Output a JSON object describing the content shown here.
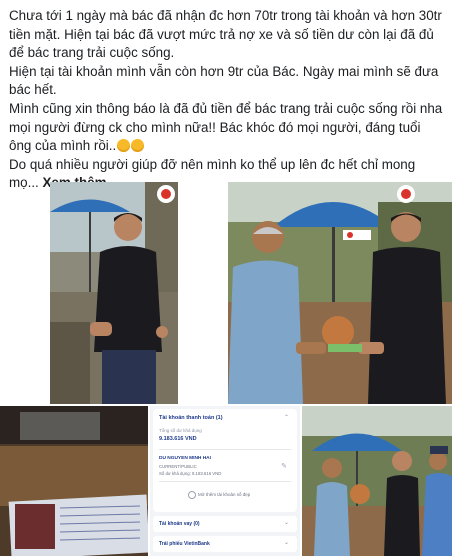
{
  "post": {
    "line1": "Chưa tới 1 ngày mà bác đã nhận đc hơn 70tr trong tài khoản và hơn 30tr tiền mặt. Hiện tại bác đã vượt mức trả nợ xe và số tiền dư còn lại đã đủ để bác trang trải cuộc sống.",
    "line2": "Hiện tại tài khoản mình vẫn còn hơn 9tr của Bác. Ngày mai mình sẽ đưa bác hết.",
    "line3": "Mình cũng xin thông báo là đã đủ tiền để bác trang trải cuộc sống rồi nha mọi người đừng ck cho mình nữa!! Bác khóc đó mọi người, đáng tuổi ông của mình rồi..",
    "line4": "Do quá nhiều người giúp đỡ nên mình ko thể up lên đc hết chỉ mong mọ...",
    "see_more": "Xem thêm"
  },
  "bank_app": {
    "card_title": "Tài khoản thanh toán (1)",
    "balance_label": "Tổng số dư khả dụng",
    "balance_value": "9.183.616 VND",
    "holder_name": "DU NGUYEN MINH HAI",
    "account_type": "CURRENT/PUBLIC",
    "account_balance": "Số dư khả dụng: 9.183.616 VND",
    "add_account": "Mở thêm tài khoản số đẹp",
    "row_loan": "Tài khoản vay (0)",
    "row_bond": "Trái phiếu VietinBank"
  },
  "colors": {
    "text": "#1c1e21",
    "bank_blue": "#1e3a8a",
    "umbrella_blue": "#2f6fb8"
  }
}
